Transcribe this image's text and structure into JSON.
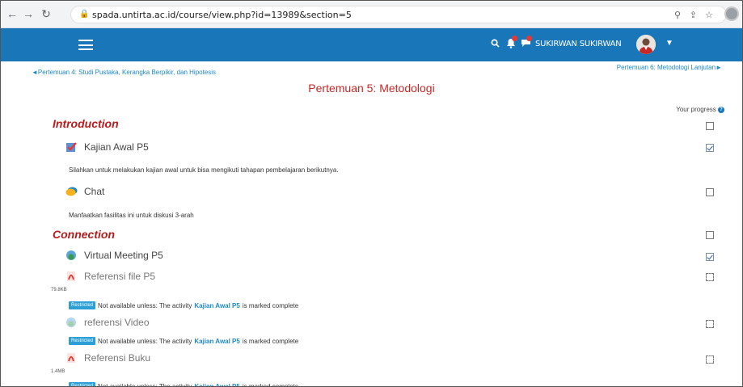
{
  "browser": {
    "url": "spada.untirta.ac.id/course/view.php?id=13989&section=5"
  },
  "navbar": {
    "user_name": "SUKIRWAN SUKIRWAN",
    "brand_color": "#1976b8"
  },
  "section_nav": {
    "prev": "◄Pertemuan 4: Studi Pustaka, Kerangka Berpikir, dan Hipotesis",
    "next": "Pertemuan 6: Metodologi Lanjutan►"
  },
  "section_title": "Pertemuan 5: Metodologi",
  "progress_label": "Your progress",
  "introduction": {
    "heading": "Introduction",
    "kajian": {
      "name": "Kajian Awal P5",
      "completed": true
    },
    "kajian_desc": "Silahkan untuk melakukan kajian awal untuk bisa mengikuti tahapan pembelajaran berikutnya.",
    "chat": {
      "name": "Chat",
      "completed": false
    },
    "chat_desc": "Manfaatkan fasilitas ini untuk diskusi 3-arah"
  },
  "connection": {
    "heading": "Connection",
    "virtual_meeting": {
      "name": "Virtual Meeting P5",
      "completed": true
    },
    "ref_file": {
      "name": "Referensi file P5",
      "size": "79.8KB",
      "completed": false
    },
    "ref_video": {
      "name": "referensi Video",
      "completed": false
    },
    "ref_buku": {
      "name": "Referensi Buku",
      "size": "1.4MB",
      "completed": false
    }
  },
  "restriction": {
    "badge": "Restricted",
    "prefix": "Not available unless: The activity",
    "activity": "Kajian Awal P5",
    "suffix": "is marked complete"
  }
}
